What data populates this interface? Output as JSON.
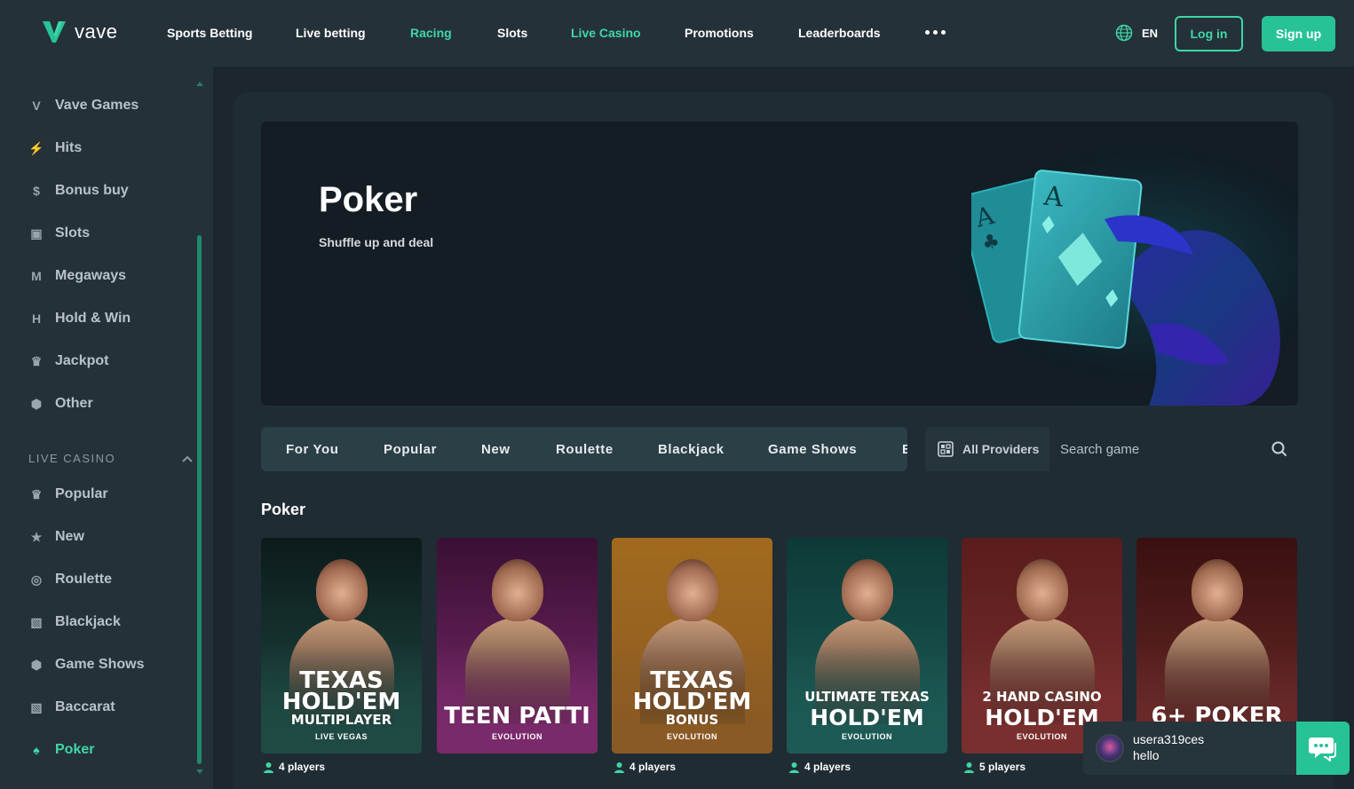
{
  "header": {
    "logo_text": "vave",
    "nav": [
      {
        "label": "Sports Betting",
        "green": false
      },
      {
        "label": "Live betting",
        "green": false
      },
      {
        "label": "Racing",
        "green": true
      },
      {
        "label": "Slots",
        "green": false
      },
      {
        "label": "Live Casino",
        "green": true
      },
      {
        "label": "Promotions",
        "green": false
      },
      {
        "label": "Leaderboards",
        "green": false
      }
    ],
    "more_icon": "more-dots-icon",
    "language": "EN",
    "login_label": "Log in",
    "signup_label": "Sign up"
  },
  "sidebar": {
    "items": [
      {
        "label": "Vave Games",
        "icon": "vave-icon"
      },
      {
        "label": "Hits",
        "icon": "lightning-icon"
      },
      {
        "label": "Bonus buy",
        "icon": "money-bag-icon"
      },
      {
        "label": "Slots",
        "icon": "slot-machine-icon"
      },
      {
        "label": "Megaways",
        "icon": "megaways-icon"
      },
      {
        "label": "Hold & Win",
        "icon": "hold-win-icon"
      },
      {
        "label": "Jackpot",
        "icon": "jackpot-icon"
      },
      {
        "label": "Other",
        "icon": "dice-icon"
      }
    ],
    "section_label": "LIVE CASINO",
    "live_items": [
      {
        "label": "Popular",
        "icon": "crown-icon"
      },
      {
        "label": "New",
        "icon": "star-icon"
      },
      {
        "label": "Roulette",
        "icon": "roulette-icon"
      },
      {
        "label": "Blackjack",
        "icon": "cards-icon"
      },
      {
        "label": "Game Shows",
        "icon": "dice-icon"
      },
      {
        "label": "Baccarat",
        "icon": "cards-icon"
      },
      {
        "label": "Poker",
        "icon": "poker-card-icon",
        "active": true
      }
    ]
  },
  "hero": {
    "title": "Poker",
    "subtitle": "Shuffle up and deal",
    "card_rank": "A"
  },
  "tabs": [
    "For You",
    "Popular",
    "New",
    "Roulette",
    "Blackjack",
    "Game Shows",
    "E"
  ],
  "providers_label": "All Providers",
  "search": {
    "placeholder": "Search game"
  },
  "section_title": "Poker",
  "games": [
    {
      "lines": [
        "TEXAS",
        "HOLD'EM",
        "MULTIPLAYER"
      ],
      "provider": "LIVE VEGAS",
      "players": "4 players",
      "bg": "#1f4a44",
      "accent": "#0c1a1a"
    },
    {
      "lines": [
        "TEEN PATTI"
      ],
      "provider": "EVOLUTION",
      "players": "",
      "bg": "#7a2a6a",
      "accent": "#3a0f35"
    },
    {
      "lines": [
        "TEXAS",
        "HOLD'EM",
        "BONUS"
      ],
      "provider": "EVOLUTION",
      "players": "4 players",
      "bg": "#8a5a24",
      "accent": "#a16a1e"
    },
    {
      "lines": [
        "ULTIMATE TEXAS",
        "HOLD'EM"
      ],
      "provider": "EVOLUTION",
      "players": "4 players",
      "bg": "#1d5a55",
      "accent": "#0d3a37"
    },
    {
      "lines": [
        "2 HAND CASINO",
        "HOLD'EM"
      ],
      "provider": "EVOLUTION",
      "players": "5 players",
      "bg": "#7a2f2f",
      "accent": "#5a1c1c"
    },
    {
      "lines": [
        "6+ POKER"
      ],
      "provider": "",
      "players": "",
      "bg": "#6a2a2a",
      "accent": "#3a1010"
    }
  ],
  "chat": {
    "username": "usera319ces",
    "message": "hello"
  },
  "colors": {
    "accent": "#3fd6a6",
    "brand_button": "#27c397",
    "background": "#1b262d"
  }
}
